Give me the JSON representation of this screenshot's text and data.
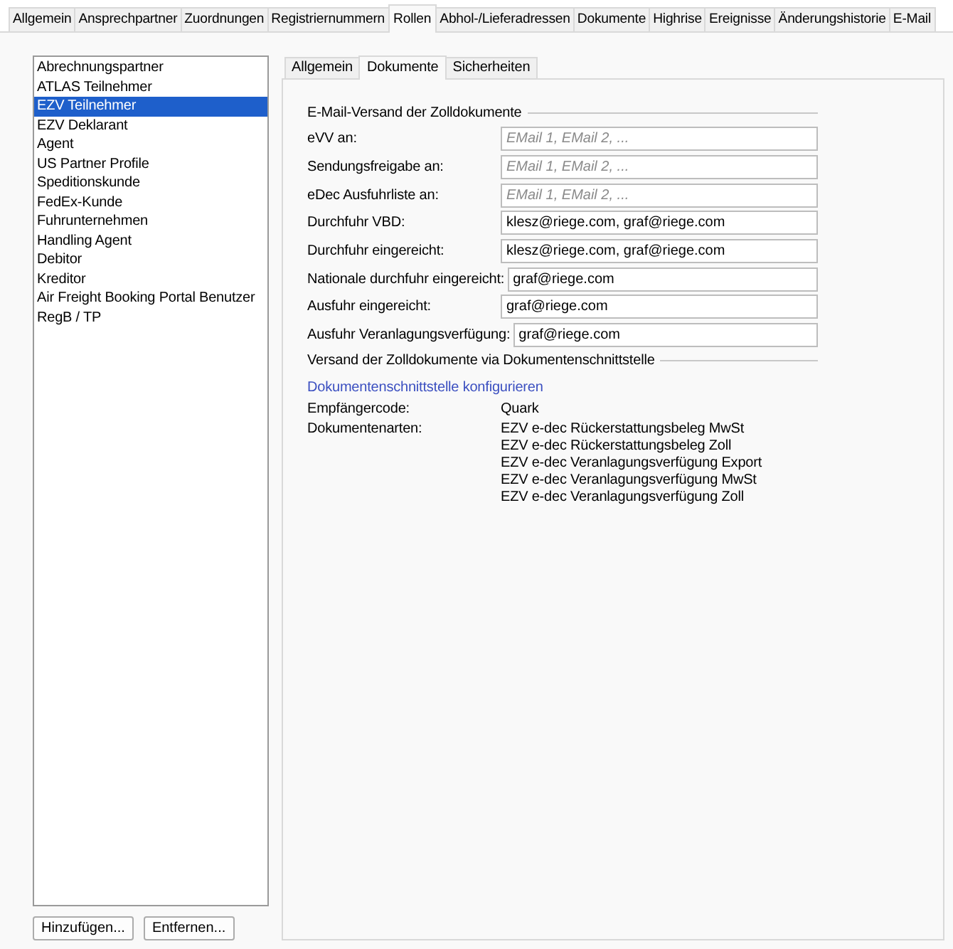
{
  "tabs": [
    {
      "label": "Allgemein",
      "selected": false
    },
    {
      "label": "Ansprechpartner",
      "selected": false
    },
    {
      "label": "Zuordnungen",
      "selected": false
    },
    {
      "label": "Registriernummern",
      "selected": false
    },
    {
      "label": "Rollen",
      "selected": true
    },
    {
      "label": "Abhol-/Lieferadressen",
      "selected": false
    },
    {
      "label": "Dokumente",
      "selected": false
    },
    {
      "label": "Highrise",
      "selected": false
    },
    {
      "label": "Ereignisse",
      "selected": false
    },
    {
      "label": "Änderungshistorie",
      "selected": false
    },
    {
      "label": "E-Mail",
      "selected": false
    }
  ],
  "roles": {
    "items": [
      {
        "label": "Abrechnungspartner",
        "selected": false
      },
      {
        "label": "ATLAS Teilnehmer",
        "selected": false
      },
      {
        "label": "EZV Teilnehmer",
        "selected": true
      },
      {
        "label": "EZV Deklarant",
        "selected": false
      },
      {
        "label": "Agent",
        "selected": false
      },
      {
        "label": "US Partner Profile",
        "selected": false
      },
      {
        "label": "Speditionskunde",
        "selected": false
      },
      {
        "label": "FedEx-Kunde",
        "selected": false
      },
      {
        "label": "Fuhrunternehmen",
        "selected": false
      },
      {
        "label": "Handling Agent",
        "selected": false
      },
      {
        "label": "Debitor",
        "selected": false
      },
      {
        "label": "Kreditor",
        "selected": false
      },
      {
        "label": "Air Freight Booking Portal Benutzer",
        "selected": false
      },
      {
        "label": "RegB / TP",
        "selected": false
      }
    ],
    "buttons": [
      "Hinzufügen...",
      "Entfernen..."
    ]
  },
  "sub_tabs": [
    {
      "label": "Allgemein",
      "selected": false
    },
    {
      "label": "Dokumente",
      "selected": true
    },
    {
      "label": "Sicherheiten",
      "selected": false
    }
  ],
  "email_section": {
    "title": "E-Mail-Versand der Zolldokumente",
    "fields": [
      {
        "label": "eVV an:",
        "placeholder": "EMail 1, EMail 2, ..."
      },
      {
        "label": "Sendungsfreigabe an:",
        "placeholder": "EMail 1, EMail 2, ..."
      },
      {
        "label": "eDec Ausfuhrliste an:",
        "placeholder": "EMail 1, EMail 2, ..."
      },
      {
        "label": "Durchfuhr VBD:",
        "value": "klesz@riege.com, graf@riege.com"
      },
      {
        "label": "Durchfuhr eingereicht:",
        "value": "klesz@riege.com, graf@riege.com"
      },
      {
        "label": "Nationale durchfuhr eingereicht:",
        "value": "graf@riege.com"
      },
      {
        "label": "Ausfuhr eingereicht:",
        "value": "graf@riege.com"
      },
      {
        "label": "Ausfuhr Veranlagungsverfügung:",
        "value": "graf@riege.com"
      }
    ]
  },
  "interface_section": {
    "title": "Versand der Zolldokumente via Dokumentenschnittstelle",
    "link": "Dokumentenschnittstelle konfigurieren",
    "fields": [
      {
        "label": "Empfängercode:",
        "values": [
          "Quark"
        ]
      },
      {
        "label": "Dokumentenarten:",
        "values": [
          "EZV e-dec Rückerstattungsbeleg MwSt",
          "EZV e-dec Rückerstattungsbeleg Zoll",
          "EZV e-dec Veranlagungsverfügung Export",
          "EZV e-dec Veranlagungsverfügung MwSt",
          "EZV e-dec Veranlagungsverfügung Zoll"
        ]
      }
    ]
  }
}
